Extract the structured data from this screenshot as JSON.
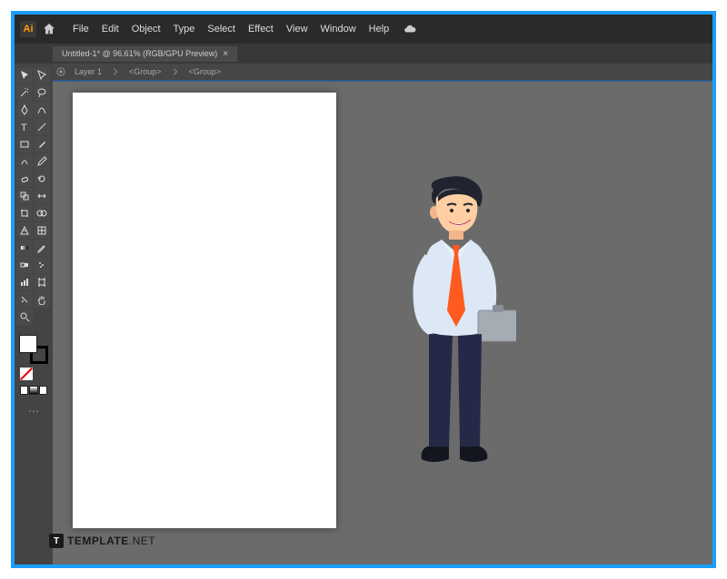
{
  "app": {
    "badge": "Ai",
    "menus": [
      "File",
      "Edit",
      "Object",
      "Type",
      "Select",
      "Effect",
      "View",
      "Window",
      "Help"
    ]
  },
  "document": {
    "tab_label": "Untitled-1* @ 96.61% (RGB/GPU Preview)"
  },
  "breadcrumb": {
    "layer": "Layer 1",
    "group1": "<Group>",
    "group2": "<Group>"
  },
  "watermark": {
    "badge": "T",
    "brand": "TEMPLATE",
    "suffix": ".NET"
  },
  "tools": {
    "selection": "selection",
    "direct": "direct-selection",
    "wand": "magic-wand",
    "lasso": "lasso",
    "pen": "pen",
    "curvature": "curvature",
    "type": "type",
    "line": "line-segment",
    "rect": "rectangle",
    "brush": "paintbrush",
    "shaper": "shaper",
    "pencil": "pencil",
    "eraser": "eraser",
    "rotate": "rotate",
    "scale": "scale",
    "width": "width",
    "free": "free-transform",
    "shapebuilder": "shape-builder",
    "perspective": "perspective",
    "mesh": "mesh",
    "gradient": "gradient",
    "eyedropper": "eyedropper",
    "blend": "blend",
    "symbol": "symbol-sprayer",
    "graph": "column-graph",
    "artboard": "artboard",
    "slice": "slice",
    "hand": "hand",
    "zoom": "zoom"
  },
  "colors": {
    "fill": "#ffffff",
    "stroke": "#000000"
  }
}
